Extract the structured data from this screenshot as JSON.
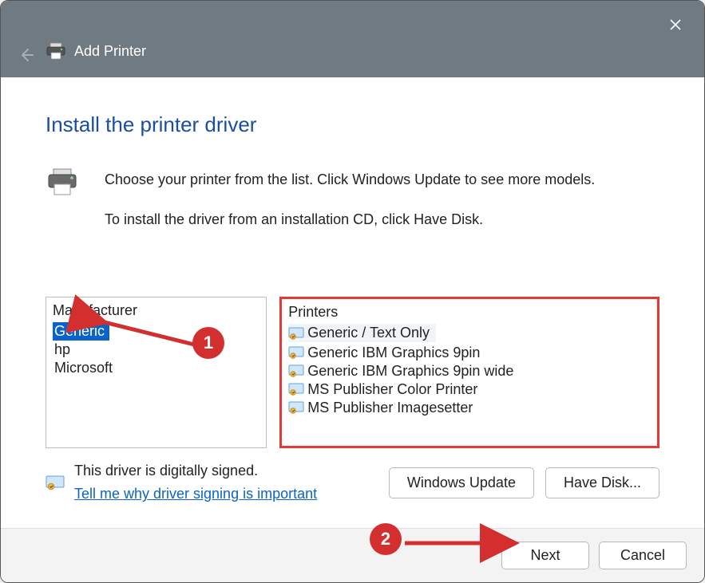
{
  "window": {
    "title": "Add Printer"
  },
  "heading": "Install the printer driver",
  "description": {
    "line1": "Choose your printer from the list. Click Windows Update to see more models.",
    "line2": "To install the driver from an installation CD, click Have Disk."
  },
  "manufacturer": {
    "header": "Manufacturer",
    "items": [
      "Generic",
      "hp",
      "Microsoft"
    ],
    "selected_index": 0
  },
  "printers": {
    "header": "Printers",
    "items": [
      "Generic / Text Only",
      "Generic IBM Graphics 9pin",
      "Generic IBM Graphics 9pin wide",
      "MS Publisher Color Printer",
      "MS Publisher Imagesetter"
    ],
    "selected_index": 0
  },
  "signature": {
    "text": "This driver is digitally signed.",
    "link": "Tell me why driver signing is important"
  },
  "buttons": {
    "windows_update": "Windows Update",
    "have_disk": "Have Disk...",
    "next": "Next",
    "cancel": "Cancel"
  },
  "annotations": {
    "n1": "1",
    "n2": "2"
  }
}
